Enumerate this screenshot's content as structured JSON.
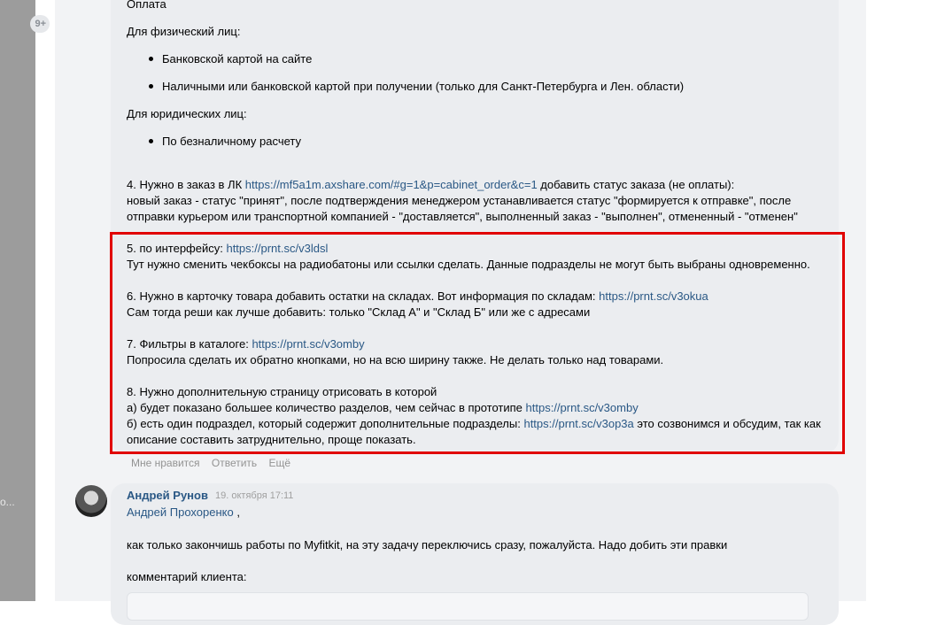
{
  "sidebar": {
    "badge": "9+",
    "dots": "о..."
  },
  "message1": {
    "payment_heading": "Оплата",
    "individuals_heading": "Для физический лиц:",
    "individuals_items": [
      "Банковской картой на сайте",
      "Наличными или банковской картой при получении (только для Санкт-Петербурга и Лен. области)"
    ],
    "legal_heading": "Для юридических лиц:",
    "legal_items": [
      "По безналичному расчету"
    ],
    "item4": {
      "prefix": "4. Нужно в заказ в ЛК ",
      "link": "https://mf5a1m.axshare.com/#g=1&p=cabinet_order&c=1",
      "suffix": " добавить статус заказа (не оплаты):",
      "line2": "новый заказ - статус \"принят\", после подтверждения менеджером устанавливается статус \"формируется к отправке\", после",
      "line3": "отправки курьером или транспортной компанией - \"доставляется\", выполненный заказ - \"выполнен\", отмененный - \"отменен\""
    },
    "item5": {
      "prefix": "5. по интерфейсу: ",
      "link": "https://prnt.sc/v3ldsl",
      "line2": "Тут нужно сменить чекбоксы на радиобатоны или ссылки сделать. Данные подразделы не могут быть выбраны одновременно."
    },
    "item6": {
      "prefix": "6. Нужно в карточку товара добавить остатки на складах. Вот информация по складам: ",
      "link": "https://prnt.sc/v3okua",
      "line2": "Сам тогда реши как лучше добавить: только \"Склад А\" и \"Склад Б\" или же с адресами"
    },
    "item7": {
      "prefix": "7. Фильтры в каталоге: ",
      "link": "https://prnt.sc/v3omby",
      "line2": "Попросила сделать их обратно кнопками, но на всю ширину также. Не делать только над товарами."
    },
    "item8": {
      "line1": "8. Нужно дополнительную страницу отрисовать в которой",
      "a_prefix": "а) будет показано большее количество разделов, чем сейчас в прототипе ",
      "a_link": "https://prnt.sc/v3omby",
      "b_prefix": "б) есть один подраздел, который содержит дополнительные подразделы: ",
      "b_link": "https://prnt.sc/v3op3a",
      "b_suffix": " это созвонимся и обсудим, так как",
      "b_line2": "описание составить затруднительно, проще показать."
    },
    "actions": {
      "like": "Мне нравится",
      "reply": "Ответить",
      "more": "Ещё"
    }
  },
  "message2": {
    "author": "Андрей Рунов",
    "date": "19. октября 17:11",
    "mention": "Андрей Прохоренко",
    "mention_suffix": " ,",
    "text": "как только закончишь работы по Myfitkit, на эту задачу переключись сразу, пожалуйста. Надо добить эти правки",
    "client_comment_label": "комментарий клиента:"
  },
  "colors": {
    "link": "#2a5885",
    "highlight_border": "#e10000",
    "bubble": "#ebedf0"
  }
}
